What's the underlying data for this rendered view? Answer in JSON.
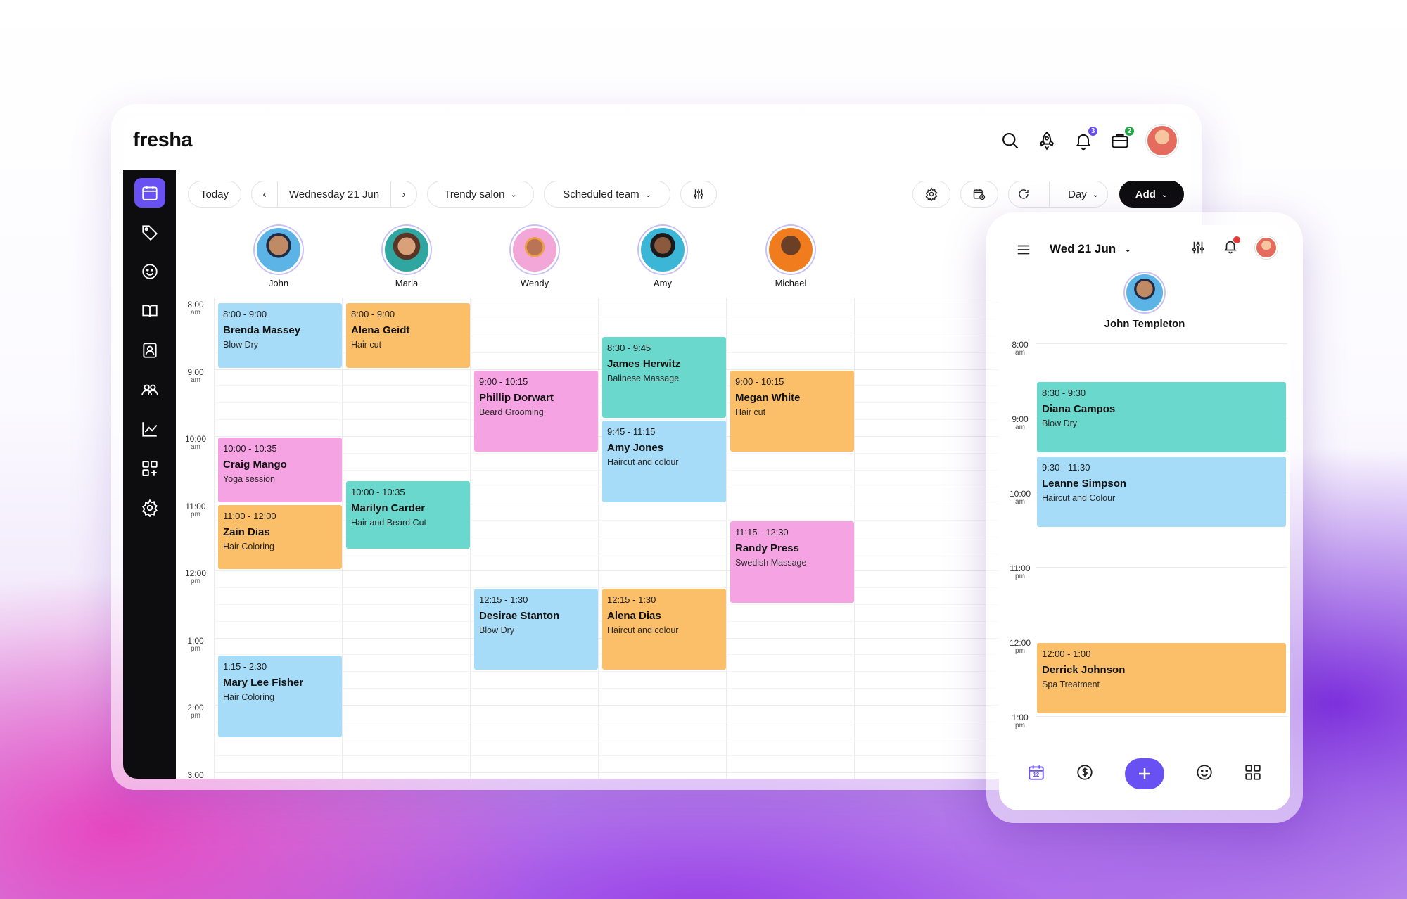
{
  "brand": {
    "logo": "fresha",
    "accent": "#6950f3"
  },
  "header": {
    "notifications_count": "3",
    "tasks_count": "2"
  },
  "toolbar": {
    "today_label": "Today",
    "date_label": "Wednesday 21 Jun",
    "location_label": "Trendy salon",
    "team_label": "Scheduled team",
    "view_label": "Day",
    "add_label": "Add"
  },
  "staff": [
    {
      "name": "John"
    },
    {
      "name": "Maria"
    },
    {
      "name": "Wendy"
    },
    {
      "name": "Amy"
    },
    {
      "name": "Michael"
    }
  ],
  "hours": [
    {
      "time": "8:00",
      "period": "am"
    },
    {
      "time": "9:00",
      "period": "am"
    },
    {
      "time": "10:00",
      "period": "am"
    },
    {
      "time": "11:00",
      "period": "pm"
    },
    {
      "time": "12:00",
      "period": "pm"
    },
    {
      "time": "1:00",
      "period": "pm"
    },
    {
      "time": "2:00",
      "period": "pm"
    },
    {
      "time": "3:00",
      "period": ""
    }
  ],
  "appointments": [
    {
      "col": 0,
      "start": 8.0,
      "end": 9.0,
      "time": "8:00 - 9:00",
      "client": "Brenda Massey",
      "service": "Blow Dry",
      "color": "#a6dcf7"
    },
    {
      "col": 0,
      "start": 10.0,
      "end": 11.0,
      "time": "10:00 - 10:35",
      "client": "Craig Mango",
      "service": "Yoga session",
      "color": "#f5a3e3"
    },
    {
      "col": 0,
      "start": 11.0,
      "end": 12.0,
      "time": "11:00 - 12:00",
      "client": "Zain Dias",
      "service": "Hair Coloring",
      "color": "#fbbf6a"
    },
    {
      "col": 0,
      "start": 13.25,
      "end": 14.5,
      "time": "1:15 - 2:30",
      "client": "Mary Lee Fisher",
      "service": "Hair Coloring",
      "color": "#a6dcf7"
    },
    {
      "col": 1,
      "start": 8.0,
      "end": 9.0,
      "time": "8:00 - 9:00",
      "client": "Alena Geidt",
      "service": "Hair cut",
      "color": "#fbbf6a"
    },
    {
      "col": 1,
      "start": 10.65,
      "end": 11.7,
      "time": "10:00 - 10:35",
      "client": "Marilyn Carder",
      "service": "Hair and Beard Cut",
      "color": "#6ad8cd"
    },
    {
      "col": 2,
      "start": 9.0,
      "end": 10.25,
      "time": "9:00 - 10:15",
      "client": "Phillip Dorwart",
      "service": "Beard Grooming",
      "color": "#f5a3e3"
    },
    {
      "col": 2,
      "start": 12.25,
      "end": 13.5,
      "time": "12:15 - 1:30",
      "client": "Desirae Stanton",
      "service": "Blow Dry",
      "color": "#a6dcf7"
    },
    {
      "col": 3,
      "start": 8.5,
      "end": 9.75,
      "time": "8:30 - 9:45",
      "client": "James Herwitz",
      "service": "Balinese Massage",
      "color": "#6ad8cd"
    },
    {
      "col": 3,
      "start": 9.75,
      "end": 11.0,
      "time": "9:45 - 11:15",
      "client": "Amy Jones",
      "service": "Haircut and colour",
      "color": "#a6dcf7"
    },
    {
      "col": 3,
      "start": 12.25,
      "end": 13.5,
      "time": "12:15 - 1:30",
      "client": "Alena Dias",
      "service": "Haircut and colour",
      "color": "#fbbf6a"
    },
    {
      "col": 4,
      "start": 9.0,
      "end": 10.25,
      "time": "9:00 - 10:15",
      "client": "Megan White",
      "service": "Hair cut",
      "color": "#fbbf6a"
    },
    {
      "col": 4,
      "start": 11.25,
      "end": 12.5,
      "time": "11:15 - 12:30",
      "client": "Randy Press",
      "service": "Swedish Massage",
      "color": "#f5a3e3"
    }
  ],
  "mobile": {
    "date_label": "Wed 21 Jun",
    "staff_name": "John Templeton",
    "calendar_day": "12",
    "hours": [
      {
        "time": "8:00",
        "period": "am"
      },
      {
        "time": "9:00",
        "period": "am"
      },
      {
        "time": "10:00",
        "period": "am"
      },
      {
        "time": "11:00",
        "period": "pm"
      },
      {
        "time": "12:00",
        "period": "pm"
      },
      {
        "time": "1:00",
        "period": "pm"
      }
    ],
    "appointments": [
      {
        "start": 8.5,
        "end": 9.5,
        "time": "8:30 - 9:30",
        "client": "Diana Campos",
        "service": "Blow Dry",
        "color": "#6ad8cd"
      },
      {
        "start": 9.5,
        "end": 10.5,
        "time": "9:30 - 11:30",
        "client": "Leanne Simpson",
        "service": "Haircut and Colour",
        "color": "#a6dcf7"
      },
      {
        "start": 12.0,
        "end": 13.0,
        "time": "12:00 - 1:00",
        "client": "Derrick Johnson",
        "service": "Spa Treatment",
        "color": "#fbbf6a"
      }
    ]
  }
}
